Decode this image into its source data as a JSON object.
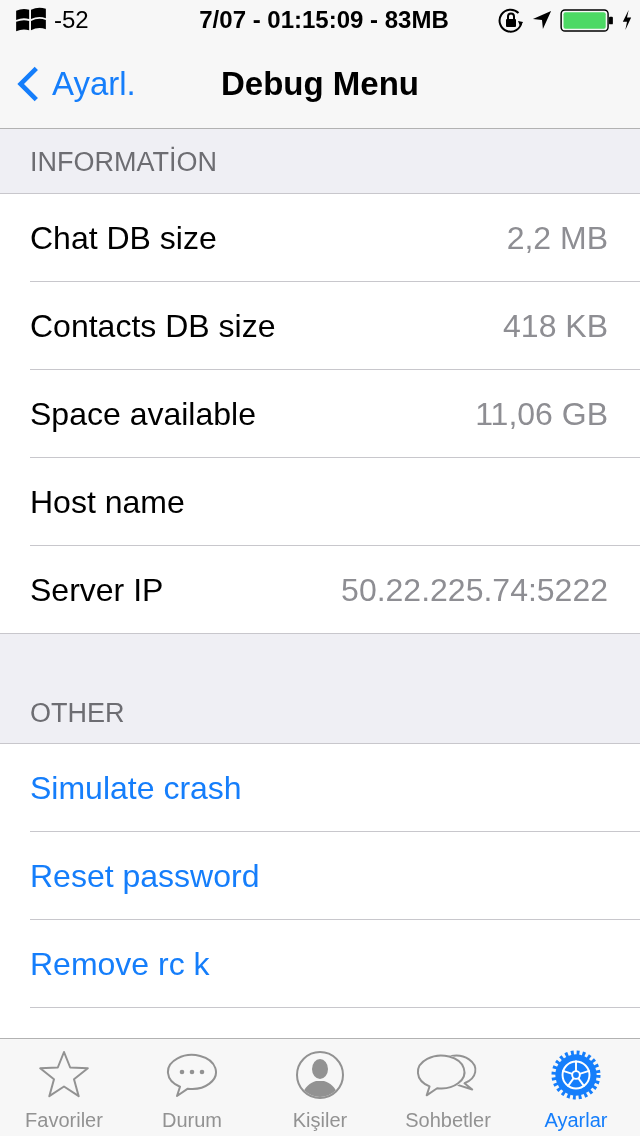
{
  "status_bar": {
    "signal": "-52",
    "center_text": "7/07 - 01:15:09 - 83MB"
  },
  "nav_bar": {
    "back_label": "Ayarl.",
    "title": "Debug Menu"
  },
  "sections": [
    {
      "header": "INFORMATİON",
      "rows": [
        {
          "kind": "info",
          "label": "Chat DB size",
          "value": "2,2 MB"
        },
        {
          "kind": "info",
          "label": "Contacts DB size",
          "value": "418 KB"
        },
        {
          "kind": "info",
          "label": "Space available",
          "value": "11,06 GB"
        },
        {
          "kind": "info",
          "label": "Host name"
        },
        {
          "kind": "info",
          "label": "Server IP",
          "value": "50.22.225.74:5222"
        }
      ]
    },
    {
      "header": "OTHER",
      "rows": [
        {
          "kind": "action",
          "label": "Simulate crash"
        },
        {
          "kind": "action",
          "label": "Reset password"
        },
        {
          "kind": "action",
          "label": "Remove rc k"
        }
      ]
    }
  ],
  "tab_bar": {
    "tabs": [
      {
        "label": "Favoriler",
        "selected": false
      },
      {
        "label": "Durum",
        "selected": false
      },
      {
        "label": "Kişiler",
        "selected": false
      },
      {
        "label": "Sohbetler",
        "selected": false
      },
      {
        "label": "Ayarlar",
        "selected": true
      }
    ]
  }
}
